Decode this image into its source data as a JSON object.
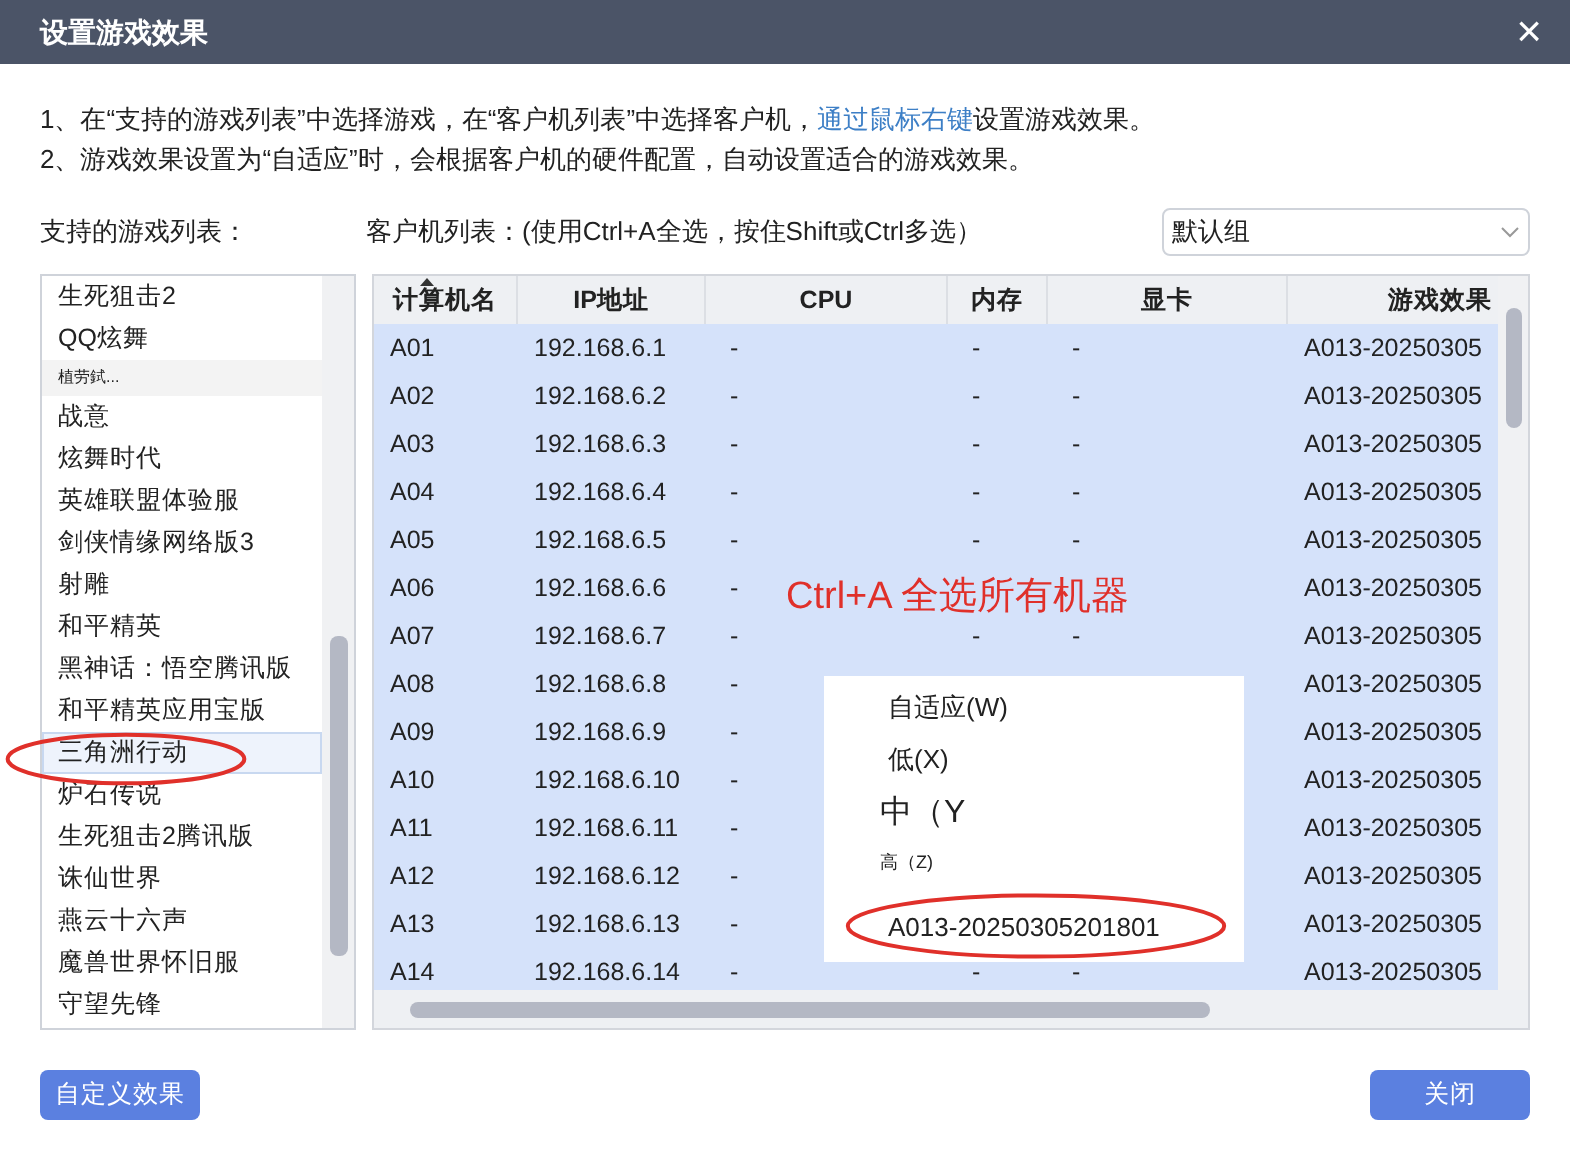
{
  "window": {
    "title": "设置游戏效果",
    "close": "×"
  },
  "instructions": [
    {
      "before": "1、在“支持的游戏列表”中选择游戏，在“客户机列表”中选择客户机，",
      "link": "通过鼠标右键",
      "after": "设置游戏效果。"
    },
    {
      "before": "2、游戏效果设置为“自适应”时，会根据客户机的硬件配置，自动设置适合的游戏效果。"
    }
  ],
  "game_list": {
    "label": "支持的游戏列表：",
    "items": [
      {
        "label": "生死狙击2",
        "selected": false,
        "kind": "normal"
      },
      {
        "label": "QQ炫舞",
        "selected": false,
        "kind": "normal"
      },
      {
        "label": "植劳鉽...",
        "selected": false,
        "kind": "compact"
      },
      {
        "label": "战意",
        "selected": false,
        "kind": "normal"
      },
      {
        "label": "炫舞时代",
        "selected": false,
        "kind": "normal"
      },
      {
        "label": "英雄联盟体验服",
        "selected": false,
        "kind": "normal"
      },
      {
        "label": "剑侠情缘网络版3",
        "selected": false,
        "kind": "normal"
      },
      {
        "label": "射雕",
        "selected": false,
        "kind": "normal"
      },
      {
        "label": "和平精英",
        "selected": false,
        "kind": "normal"
      },
      {
        "label": "黑神话：悟空腾讯版",
        "selected": false,
        "kind": "normal"
      },
      {
        "label": "和平精英应用宝版",
        "selected": false,
        "kind": "normal"
      },
      {
        "label": "三角洲行动",
        "selected": true,
        "kind": "normal"
      },
      {
        "label": "炉石传说",
        "selected": false,
        "kind": "normal"
      },
      {
        "label": "生死狙击2腾讯版",
        "selected": false,
        "kind": "normal"
      },
      {
        "label": "诛仙世界",
        "selected": false,
        "kind": "normal"
      },
      {
        "label": "燕云十六声",
        "selected": false,
        "kind": "normal"
      },
      {
        "label": "魔兽世界怀旧服",
        "selected": false,
        "kind": "normal"
      },
      {
        "label": "守望先锋",
        "selected": false,
        "kind": "normal"
      }
    ]
  },
  "client_list": {
    "label": "客户机列表：(使用Ctrl+A全选，按住Shift或Ctrl多选）",
    "group": "默认组",
    "columns": [
      "计算机名",
      "IP地址",
      "CPU",
      "内存",
      "显卡",
      "游戏效果"
    ],
    "rows": [
      {
        "name": "A01",
        "ip": "192.168.6.1",
        "cpu": "-",
        "memory": "-",
        "gpu": "-",
        "effect": "A013-20250305",
        "selected": true
      },
      {
        "name": "A02",
        "ip": "192.168.6.2",
        "cpu": "-",
        "memory": "-",
        "gpu": "-",
        "effect": "A013-20250305",
        "selected": true
      },
      {
        "name": "A03",
        "ip": "192.168.6.3",
        "cpu": "-",
        "memory": "-",
        "gpu": "-",
        "effect": "A013-20250305",
        "selected": true
      },
      {
        "name": "A04",
        "ip": "192.168.6.4",
        "cpu": "-",
        "memory": "-",
        "gpu": "-",
        "effect": "A013-20250305",
        "selected": true
      },
      {
        "name": "A05",
        "ip": "192.168.6.5",
        "cpu": "-",
        "memory": "-",
        "gpu": "-",
        "effect": "A013-20250305",
        "selected": true
      },
      {
        "name": "A06",
        "ip": "192.168.6.6",
        "cpu": "-",
        "effect": "A013-20250305",
        "selected": true
      },
      {
        "name": "A07",
        "ip": "192.168.6.7",
        "cpu": "-",
        "memory": "-",
        "gpu": "-",
        "effect": "A013-20250305",
        "selected": true
      },
      {
        "name": "A08",
        "ip": "192.168.6.8",
        "cpu": "-",
        "effect": "A013-20250305",
        "selected": true
      },
      {
        "name": "A09",
        "ip": "192.168.6.9",
        "cpu": "-",
        "effect": "A013-20250305",
        "selected": true
      },
      {
        "name": "A10",
        "ip": "192.168.6.10",
        "cpu": "-",
        "effect": "A013-20250305",
        "selected": true
      },
      {
        "name": "A11",
        "ip": "192.168.6.11",
        "cpu": "-",
        "effect": "A013-20250305",
        "selected": true
      },
      {
        "name": "A12",
        "ip": "192.168.6.12",
        "cpu": "-",
        "effect": "A013-20250305",
        "selected": true
      },
      {
        "name": "A13",
        "ip": "192.168.6.13",
        "cpu": "-",
        "effect": "A013-20250305",
        "selected": true
      },
      {
        "name": "A14",
        "ip": "192.168.6.14",
        "cpu": "-",
        "memory": "-",
        "gpu": "-",
        "effect": "A013-20250305",
        "selected": true
      }
    ]
  },
  "annotation": "Ctrl+A 全选所有机器",
  "context_menu": [
    {
      "label": "自适应(W)",
      "kind": "normal"
    },
    {
      "label": "低(X)",
      "kind": "normal"
    },
    {
      "label": "中（Y",
      "kind": "large"
    },
    {
      "label": "高（Z)",
      "kind": "small"
    },
    {
      "label": "A013-20250305201801",
      "kind": "circled"
    }
  ],
  "buttons": {
    "custom": "自定义效果",
    "close": "关闭"
  }
}
